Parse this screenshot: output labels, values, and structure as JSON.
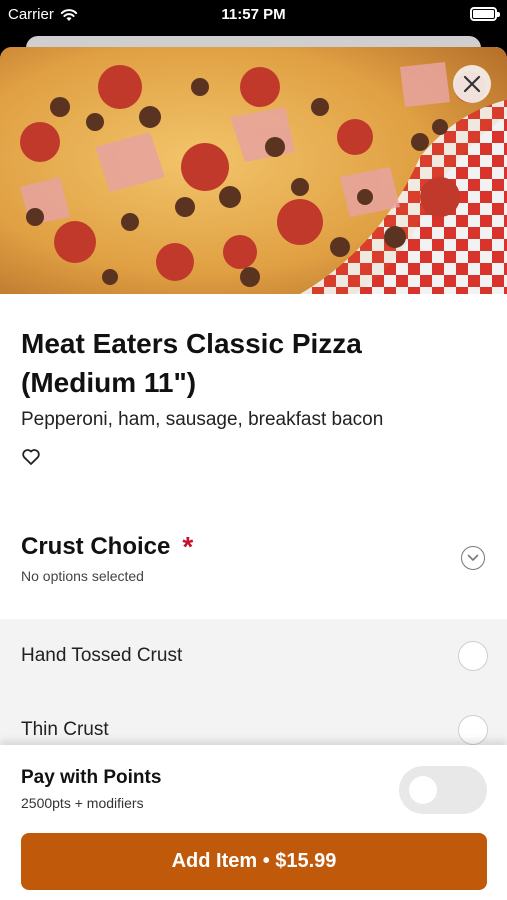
{
  "status_bar": {
    "carrier": "Carrier",
    "time": "11:57 PM",
    "wifi_icon": "wifi-icon",
    "battery_icon": "battery-icon"
  },
  "hero": {
    "image": "pizza-photo",
    "close_icon": "close-icon"
  },
  "product": {
    "title": "Meat Eaters Classic Pizza (Medium 11\")",
    "description": "Pepperoni, ham, sausage, breakfast bacon",
    "favorite_icon": "heart-icon"
  },
  "crust_section": {
    "title": "Crust Choice",
    "required_marker": "*",
    "status": "No options selected",
    "expand_icon": "chevron-down-icon",
    "options": [
      {
        "label": "Hand Tossed Crust"
      },
      {
        "label": "Thin Crust"
      }
    ]
  },
  "points": {
    "title": "Pay with Points",
    "subtitle": "2500pts + modifiers",
    "enabled": false
  },
  "cta": {
    "label": "Add Item • $15.99"
  },
  "colors": {
    "accent": "#c05a0a",
    "required": "#c8102e",
    "options_bg": "#f3f3f3"
  }
}
